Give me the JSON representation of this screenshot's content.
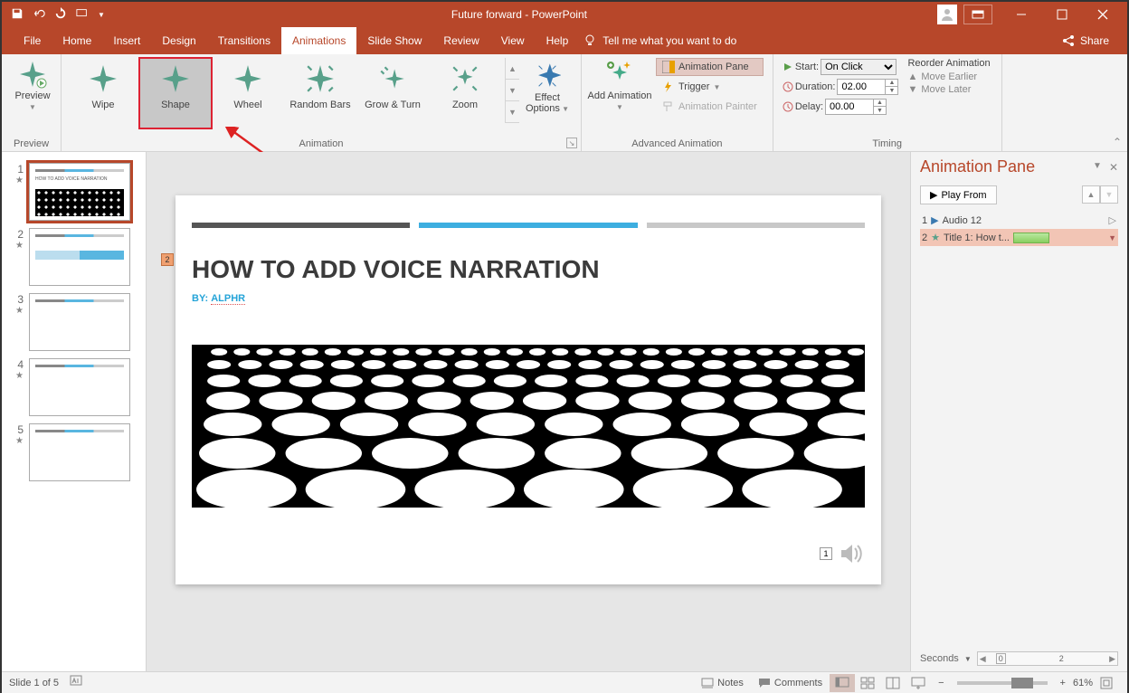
{
  "titlebar": {
    "title": "Future forward  -  PowerPoint"
  },
  "menus": {
    "file": "File",
    "home": "Home",
    "insert": "Insert",
    "design": "Design",
    "transitions": "Transitions",
    "animations": "Animations",
    "slideshow": "Slide Show",
    "review": "Review",
    "view": "View",
    "help": "Help",
    "tell": "Tell me what you want to do",
    "share": "Share"
  },
  "ribbon": {
    "preview": "Preview",
    "preview_group": "Preview",
    "gallery": {
      "wipe": "Wipe",
      "shape": "Shape",
      "wheel": "Wheel",
      "random": "Random Bars",
      "grow": "Grow & Turn",
      "zoom": "Zoom"
    },
    "animation_group": "Animation",
    "effect": "Effect Options",
    "add": "Add Animation",
    "adv": {
      "pane": "Animation Pane",
      "trigger": "Trigger",
      "painter": "Animation Painter",
      "group": "Advanced Animation"
    },
    "timing": {
      "start": "Start:",
      "start_val": "On Click",
      "duration": "Duration:",
      "duration_val": "02.00",
      "delay": "Delay:",
      "delay_val": "00.00",
      "group": "Timing"
    },
    "reorder": {
      "hdr": "Reorder Animation",
      "earlier": "Move Earlier",
      "later": "Move Later"
    }
  },
  "thumbs": [
    "1",
    "2",
    "3",
    "4",
    "5"
  ],
  "slide": {
    "title": "HOW TO ADD VOICE NARRATION",
    "by_label": "BY: ",
    "by": "ALPHR",
    "tag": "2",
    "audio_num": "1"
  },
  "pane": {
    "title": "Animation Pane",
    "play": "Play From",
    "items": [
      {
        "n": "1",
        "label": "Audio 12"
      },
      {
        "n": "2",
        "label": "Title 1: How t..."
      }
    ],
    "seconds": "Seconds",
    "s0": "0",
    "s2": "2"
  },
  "status": {
    "slide": "Slide 1 of 5",
    "notes": "Notes",
    "comments": "Comments",
    "zoom": "61%"
  }
}
